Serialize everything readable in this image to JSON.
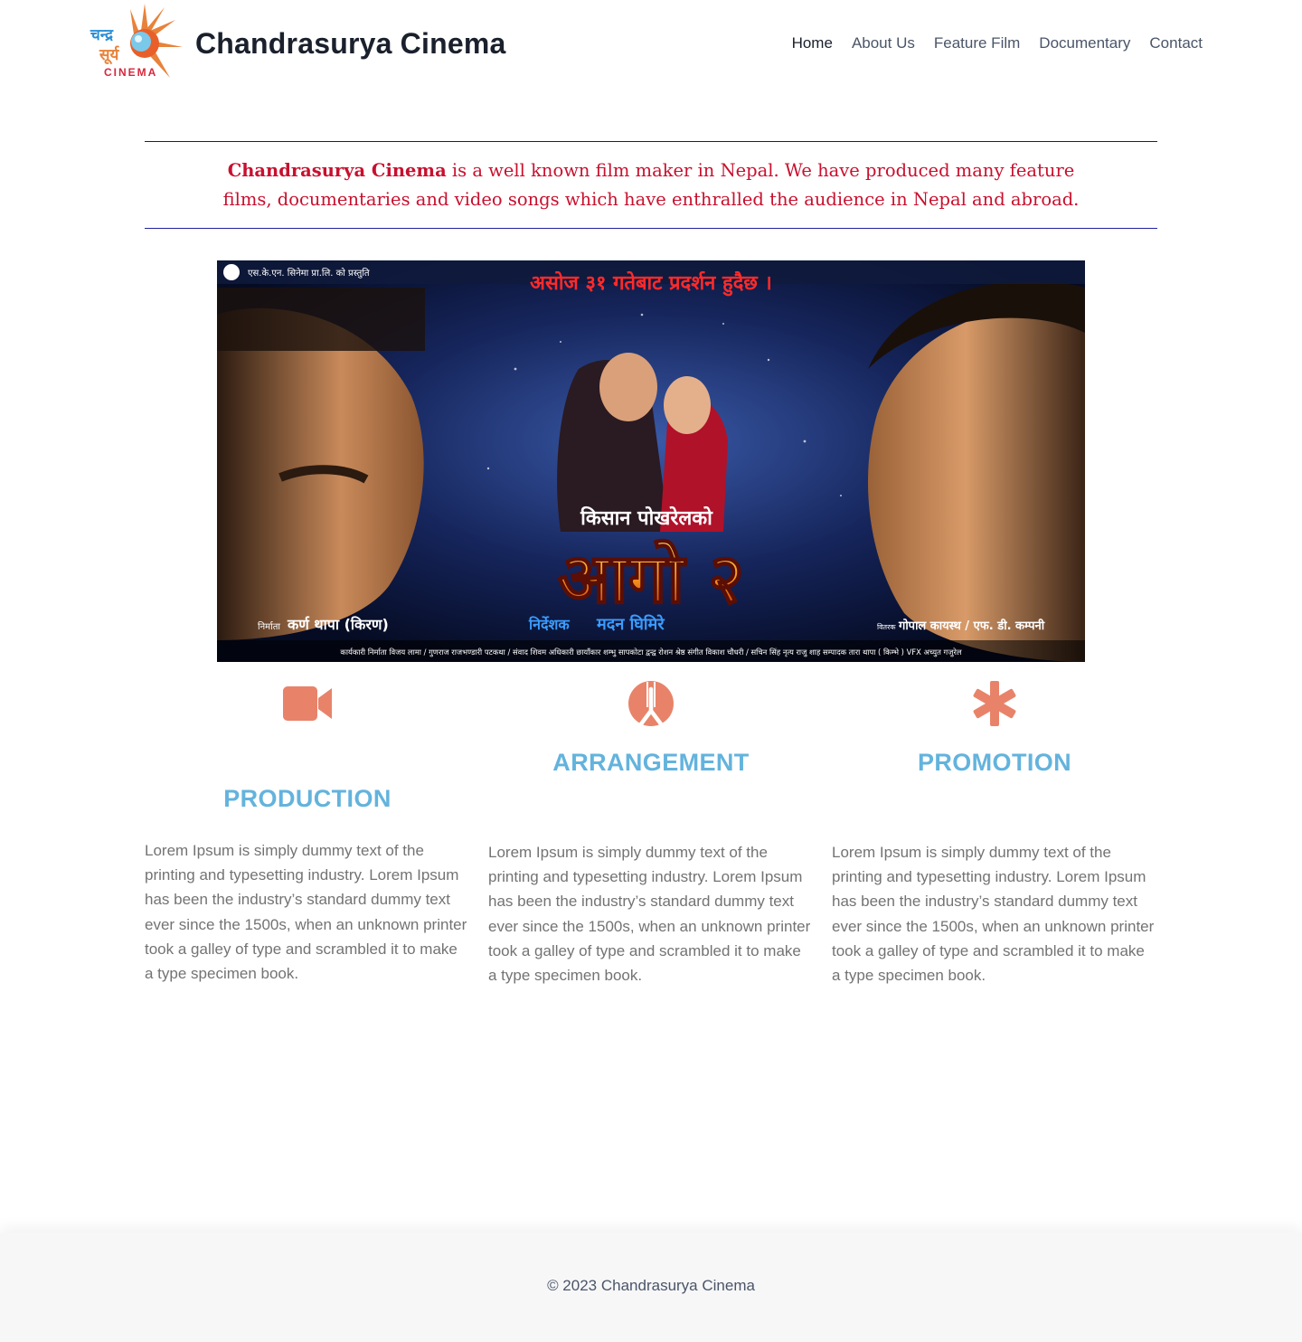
{
  "site": {
    "title": "Chandrasurya Cinema",
    "logo": {
      "text_top": "चन्द्र",
      "text_mid": "सूर्य",
      "text_bottom": "CINEMA"
    }
  },
  "nav": {
    "items": [
      {
        "label": "Home",
        "active": true
      },
      {
        "label": "About Us"
      },
      {
        "label": "Feature Film"
      },
      {
        "label": "Documentary"
      },
      {
        "label": "Contact"
      }
    ]
  },
  "intro": {
    "brand": "Chandrasurya Cinema",
    "text": " is a well known film maker in Nepal. We have produced many feature films, documentaries and video songs which have enthralled the audience in Nepal and abroad."
  },
  "poster": {
    "presenter": "एस.के.एन. सिनेमा प्रा.लि. को प्रस्तुति",
    "release": "असोज ३१ गतेबाट प्रदर्शन हुदैछ ।",
    "subtitle": "किसान पोखरेलको",
    "title": "आगो २",
    "director_label": "निर्देशक",
    "director": "मदन घिमिरे",
    "producer_label": "निर्माता",
    "producer": "कर्ण थापा (किरण)",
    "distributor_label": "वितरक",
    "distributor": "गोपाल कायस्थ / एफ. डी. कम्पनी",
    "credits": "कार्यकारी निर्माता विजय लामा / गुणराज राजभण्डारी पटकथा / संवाद शिवम अधिकारी छायाँकार शम्भु सापकोटा द्वन्द्व रोशन श्रेष्ठ संगीत विकाश चौधरी / सचिन सिंह नृत्य राजु शाह सम्पादक तारा थापा ( किम्भे ) VFX अच्युत गजुरेल"
  },
  "features": [
    {
      "title": "PRODUCTION",
      "icon": "video-camera-icon",
      "text": "Lorem Ipsum is simply dummy text of the printing and typesetting industry. Lorem Ipsum has been the industry’s standard dummy text ever since the 1500s, when an unknown printer took a galley of type and scrambled it to make a type specimen book."
    },
    {
      "title": "ARRANGEMENT",
      "icon": "renren-icon",
      "text": "Lorem Ipsum is simply dummy text of the printing and typesetting industry. Lorem Ipsum has been the industry’s standard dummy text ever since the 1500s, when an unknown printer took a galley of type and scrambled it to make a type specimen book."
    },
    {
      "title": "PROMOTION",
      "icon": "asterisk-icon",
      "text": "Lorem Ipsum is simply dummy text of the printing and typesetting industry. Lorem Ipsum has been the industry’s standard dummy text ever since the 1500s, when an unknown printer took a galley of type and scrambled it to make a type specimen book."
    }
  ],
  "footer": {
    "copyright": "© 2023 Chandrasurya Cinema"
  },
  "colors": {
    "accent_icon": "#e8836a",
    "heading_blue": "#63b3dd",
    "intro_red": "#c8102e"
  }
}
